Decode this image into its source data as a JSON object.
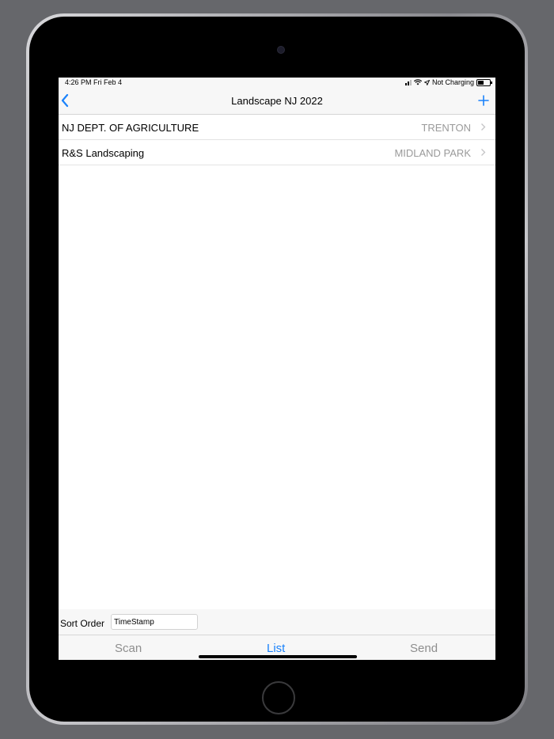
{
  "status_bar": {
    "time_date": "4:26 PM   Fri Feb 4",
    "battery_text": "Not Charging"
  },
  "nav": {
    "title": "Landscape NJ 2022",
    "back_icon": "chevron-left-icon",
    "add_icon": "plus-icon",
    "accent_color": "#1a82fb"
  },
  "list": {
    "items": [
      {
        "title": "NJ DEPT. OF AGRICULTURE",
        "detail": "TRENTON"
      },
      {
        "title": "R&S Landscaping",
        "detail": "MIDLAND PARK"
      }
    ]
  },
  "sort": {
    "label": "Sort Order",
    "value": "TimeStamp"
  },
  "tabs": {
    "scan": "Scan",
    "list": "List",
    "send": "Send",
    "active": "List"
  }
}
